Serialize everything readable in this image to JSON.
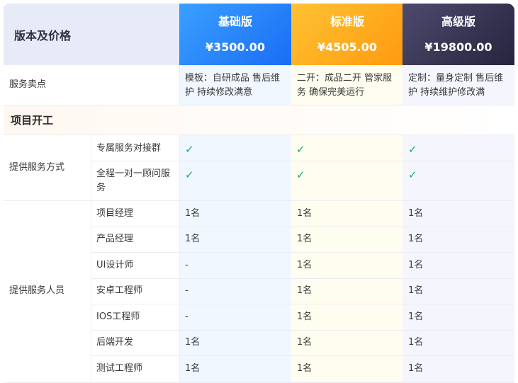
{
  "header": {
    "label": "版本及价格",
    "plans": [
      {
        "name": "基础版",
        "price": "¥3500.00"
      },
      {
        "name": "标准版",
        "price": "¥4505.00"
      },
      {
        "name": "高级版",
        "price": "¥19800.00"
      }
    ]
  },
  "selling_points": {
    "label": "服务卖点",
    "basic": "模板：自研成品 售后维护 持续修改满意",
    "standard": "二开：成品二开 管家服务 确保完美运行",
    "advanced": "定制：量身定制 售后维护 持续维护修改满"
  },
  "section": {
    "title": "项目开工"
  },
  "service_mode": {
    "label": "提供服务方式",
    "rows": [
      {
        "name": "专属服务对接群",
        "basic": "✓",
        "standard": "✓",
        "advanced": "✓"
      },
      {
        "name": "全程一对一顾问服务",
        "basic": "✓",
        "standard": "✓",
        "advanced": "✓"
      }
    ]
  },
  "staff": {
    "label": "提供服务人员",
    "rows": [
      {
        "name": "项目经理",
        "basic": "1名",
        "standard": "1名",
        "advanced": "1名"
      },
      {
        "name": "产品经理",
        "basic": "1名",
        "standard": "1名",
        "advanced": "1名"
      },
      {
        "name": "UI设计师",
        "basic": "-",
        "standard": "1名",
        "advanced": "1名"
      },
      {
        "name": "安卓工程师",
        "basic": "-",
        "standard": "1名",
        "advanced": "1名"
      },
      {
        "name": "IOS工程师",
        "basic": "-",
        "standard": "1名",
        "advanced": "1名"
      },
      {
        "name": "后端开发",
        "basic": "1名",
        "standard": "1名",
        "advanced": "1名"
      },
      {
        "name": "测试工程师",
        "basic": "1名",
        "standard": "1名",
        "advanced": "1名"
      }
    ]
  },
  "colors": {
    "check": "#19a873",
    "basic": "#1a6df5",
    "standard": "#ff9a0f",
    "advanced": "#26243d"
  }
}
